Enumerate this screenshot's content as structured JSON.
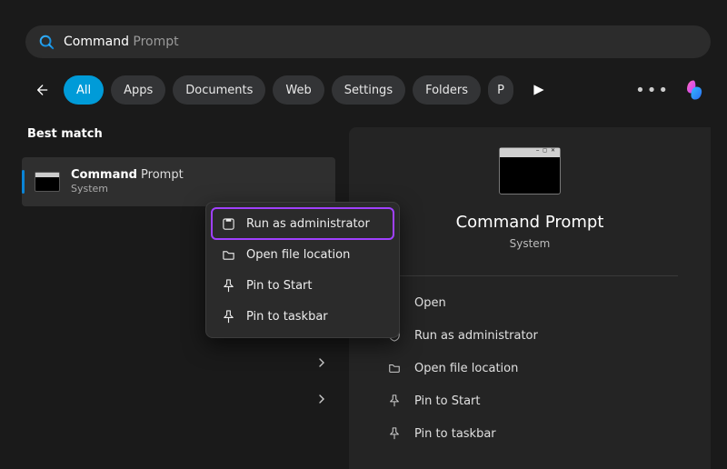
{
  "search": {
    "typed": "Command ",
    "suggestion": "Prompt"
  },
  "filters": {
    "tabs": [
      "All",
      "Apps",
      "Documents",
      "Web",
      "Settings",
      "Folders",
      "P"
    ],
    "active_index": 0
  },
  "left": {
    "section_label": "Best match",
    "result": {
      "title_bold": "Command",
      "title_rest": " Prompt",
      "subtitle": "System"
    }
  },
  "preview": {
    "title": "Command Prompt",
    "subtitle": "System",
    "actions": [
      {
        "icon": "link-icon",
        "label": "Open"
      },
      {
        "icon": "shield-icon",
        "label": "Run as administrator"
      },
      {
        "icon": "folder-icon",
        "label": "Open file location"
      },
      {
        "icon": "pin-icon",
        "label": "Pin to Start"
      },
      {
        "icon": "pin-icon",
        "label": "Pin to taskbar"
      }
    ]
  },
  "context_menu": {
    "items": [
      {
        "icon": "shield-icon",
        "label": "Run as administrator",
        "highlight": true
      },
      {
        "icon": "folder-icon",
        "label": "Open file location",
        "highlight": false
      },
      {
        "icon": "pin-icon",
        "label": "Pin to Start",
        "highlight": false
      },
      {
        "icon": "pin-icon",
        "label": "Pin to taskbar",
        "highlight": false
      }
    ]
  }
}
